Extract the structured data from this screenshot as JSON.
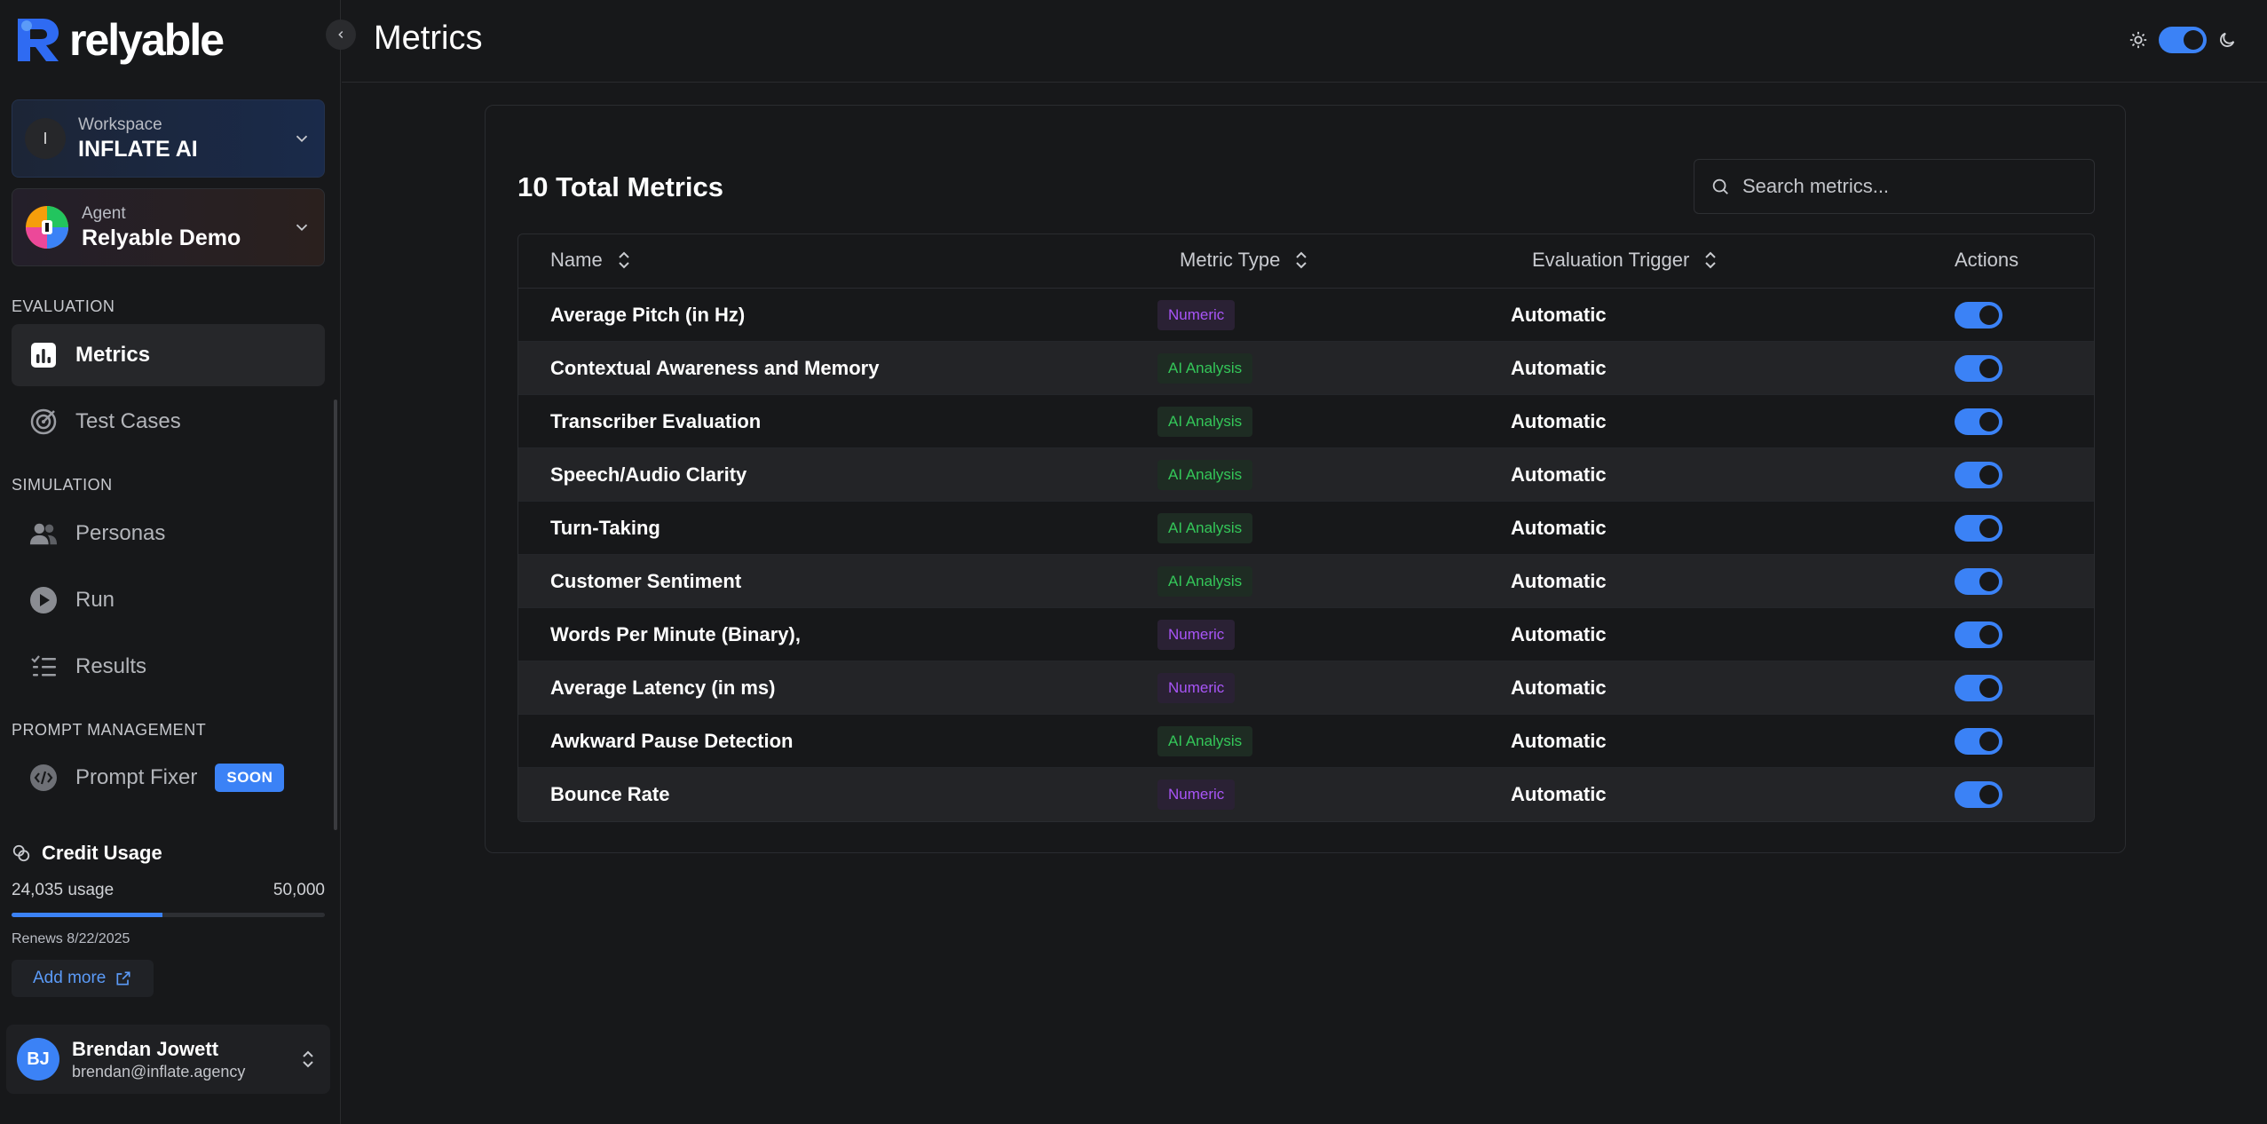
{
  "brand": {
    "name": "relyable"
  },
  "workspace": {
    "label": "Workspace",
    "value": "INFLATE AI",
    "initial": "I"
  },
  "agent": {
    "label": "Agent",
    "value": "Relyable Demo"
  },
  "sidebar": {
    "sections": [
      {
        "title": "EVALUATION"
      },
      {
        "title": "SIMULATION"
      },
      {
        "title": "PROMPT MANAGEMENT"
      }
    ],
    "items": [
      {
        "label": "Metrics",
        "icon": "chart-icon",
        "active": true
      },
      {
        "label": "Test Cases",
        "icon": "target-icon"
      },
      {
        "label": "Personas",
        "icon": "users-icon"
      },
      {
        "label": "Run",
        "icon": "play-icon"
      },
      {
        "label": "Results",
        "icon": "list-check-icon"
      },
      {
        "label": "Prompt Fixer",
        "icon": "code-icon",
        "badge": "SOON"
      }
    ]
  },
  "credit": {
    "title": "Credit Usage",
    "usage_text": "24,035 usage",
    "limit_text": "50,000",
    "used_fraction": 0.4807,
    "renews": "Renews 8/22/2025",
    "add_more": "Add more"
  },
  "user": {
    "initials": "BJ",
    "name": "Brendan Jowett",
    "email": "brendan@inflate.agency"
  },
  "header": {
    "title": "Metrics",
    "theme_toggle_on": true
  },
  "metrics": {
    "total_title": "10 Total Metrics",
    "search_placeholder": "Search metrics...",
    "columns": {
      "name": "Name",
      "type": "Metric Type",
      "trigger": "Evaluation Trigger",
      "actions": "Actions"
    },
    "rows": [
      {
        "name": "Average Pitch (in Hz)",
        "type": "Numeric",
        "trigger": "Automatic",
        "enabled": true
      },
      {
        "name": "Contextual Awareness and Memory",
        "type": "AI Analysis",
        "trigger": "Automatic",
        "enabled": true
      },
      {
        "name": "Transcriber Evaluation",
        "type": "AI Analysis",
        "trigger": "Automatic",
        "enabled": true
      },
      {
        "name": "Speech/Audio Clarity",
        "type": "AI Analysis",
        "trigger": "Automatic",
        "enabled": true
      },
      {
        "name": "Turn-Taking",
        "type": "AI Analysis",
        "trigger": "Automatic",
        "enabled": true
      },
      {
        "name": "Customer Sentiment",
        "type": "AI Analysis",
        "trigger": "Automatic",
        "enabled": true
      },
      {
        "name": "Words Per Minute (Binary),",
        "type": "Numeric",
        "trigger": "Automatic",
        "enabled": true
      },
      {
        "name": "Average Latency (in ms)",
        "type": "Numeric",
        "trigger": "Automatic",
        "enabled": true
      },
      {
        "name": "Awkward Pause Detection",
        "type": "AI Analysis",
        "trigger": "Automatic",
        "enabled": true
      },
      {
        "name": "Bounce Rate",
        "type": "Numeric",
        "trigger": "Automatic",
        "enabled": true
      }
    ]
  },
  "colors": {
    "accent": "#3b82f6",
    "numeric": "#a855f7",
    "ai": "#34c759"
  }
}
